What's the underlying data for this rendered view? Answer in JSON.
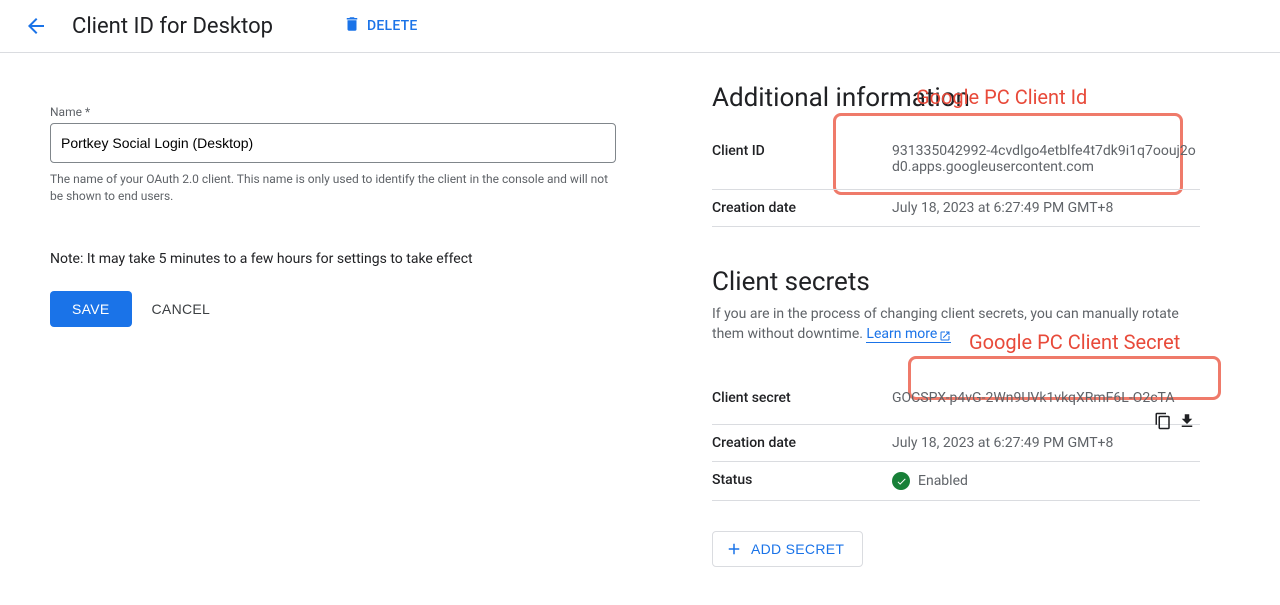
{
  "header": {
    "title": "Client ID for Desktop",
    "delete_label": "DELETE"
  },
  "form": {
    "name_label": "Name *",
    "name_value": "Portkey Social Login (Desktop)",
    "name_helper": "The name of your OAuth 2.0 client. This name is only used to identify the client in the console and will not be shown to end users.",
    "note": "Note: It may take 5 minutes to a few hours for settings to take effect",
    "save_label": "SAVE",
    "cancel_label": "CANCEL"
  },
  "additional": {
    "heading": "Additional information",
    "client_id_label": "Client ID",
    "client_id_value": "931335042992-4cvdlgo4etblfe4t7dk9i1q7oouj2od0.apps.googleusercontent.com",
    "creation_date_label": "Creation date",
    "creation_date_value": "July 18, 2023 at 6:27:49 PM GMT+8"
  },
  "secrets": {
    "heading": "Client secrets",
    "description": "If you are in the process of changing client secrets, you can manually rotate them without downtime. ",
    "learn_more": "Learn more",
    "secret_label": "Client secret",
    "secret_value": "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",
    "creation_date_label": "Creation date",
    "creation_date_value": "July 18, 2023 at 6:27:49 PM GMT+8",
    "status_label": "Status",
    "status_value": "Enabled",
    "add_secret_label": "ADD SECRET"
  },
  "annotations": {
    "client_id": "Google PC Client Id",
    "client_secret": "Google PC Client Secret"
  }
}
